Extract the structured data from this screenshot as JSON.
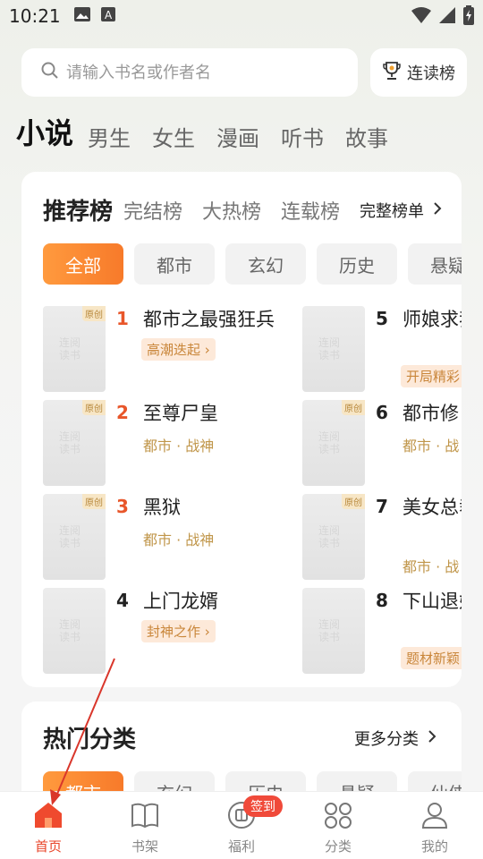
{
  "status": {
    "time": "10:21"
  },
  "search": {
    "placeholder": "请输入书名或作者名"
  },
  "rank_button": {
    "label": "连读榜"
  },
  "top_tabs": [
    "小说",
    "男生",
    "女生",
    "漫画",
    "听书",
    "故事"
  ],
  "rank_tabs": [
    "推荐榜",
    "完结榜",
    "大热榜",
    "连载榜"
  ],
  "full_list_label": "完整榜单",
  "chips": [
    "全部",
    "都市",
    "玄幻",
    "历史",
    "悬疑"
  ],
  "books": [
    {
      "rank": "1",
      "title": "都市之最强狂兵",
      "tag": "高潮迭起",
      "meta": "",
      "original": "原创"
    },
    {
      "rank": "2",
      "title": "至尊尸皇",
      "tag": "",
      "meta": "都市 · 战神",
      "original": "原创"
    },
    {
      "rank": "3",
      "title": "黑狱",
      "tag": "",
      "meta": "都市 · 战神",
      "original": "原创"
    },
    {
      "rank": "4",
      "title": "上门龙婿",
      "tag": "封神之作",
      "meta": "",
      "original": ""
    },
    {
      "rank": "5",
      "title": "师娘求我下山去祸",
      "tag": "开局精彩",
      "meta": "",
      "original": ""
    },
    {
      "rank": "6",
      "title": "都市修",
      "tag": "",
      "meta": "都市 · 战",
      "original": "原创"
    },
    {
      "rank": "7",
      "title": "美女总裁的保镖",
      "tag": "",
      "meta": "都市 · 战",
      "original": "原创"
    },
    {
      "rank": "8",
      "title": "下山退婚师娘急",
      "tag": "题材新颖",
      "meta": "",
      "original": ""
    }
  ],
  "hot": {
    "title": "热门分类",
    "more": "更多分类",
    "chips": [
      "都市",
      "玄幻",
      "历史",
      "悬疑",
      "仙侠"
    ]
  },
  "nav": [
    {
      "label": "首页",
      "icon": "home-icon"
    },
    {
      "label": "书架",
      "icon": "bookshelf-icon"
    },
    {
      "label": "福利",
      "icon": "gift-icon",
      "badge": "签到"
    },
    {
      "label": "分类",
      "icon": "category-icon"
    },
    {
      "label": "我的",
      "icon": "profile-icon"
    }
  ],
  "watermark": "连阅\n读书",
  "colors": {
    "accent": "#f26b2c",
    "nav_active": "#e8452a",
    "annotation": "#d9362b"
  }
}
